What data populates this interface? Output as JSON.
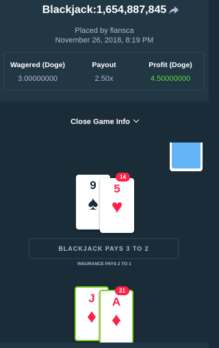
{
  "header": {
    "title": "Blackjack:1,654,887,845",
    "placed_by": "Placed by flansca",
    "date": "November 26, 2018, 8:19 PM"
  },
  "stats": {
    "wagered_label": "Wagered (Doge)",
    "wagered_value": "3.00000000",
    "payout_label": "Payout",
    "payout_value": "2.50x",
    "profit_label": "Profit (Doge)",
    "profit_value": "4.50000000"
  },
  "close_info_label": "Close Game Info",
  "dealer": {
    "score": "14",
    "cards": [
      {
        "rank": "9",
        "suit": "♠"
      },
      {
        "rank": "5",
        "suit": "♥"
      }
    ]
  },
  "table_text": {
    "blackjack_pays": "BLACKJACK PAYS 3 TO 2",
    "insurance": "INSURANCE PAYS 2 TO 1"
  },
  "player": {
    "score": "21",
    "cards": [
      {
        "rank": "J",
        "suit": "♦"
      },
      {
        "rank": "A",
        "suit": "♦"
      }
    ]
  },
  "colors": {
    "profit_green": "#5ddc3c",
    "card_red": "#fe2247",
    "win_border": "#7ed321"
  }
}
